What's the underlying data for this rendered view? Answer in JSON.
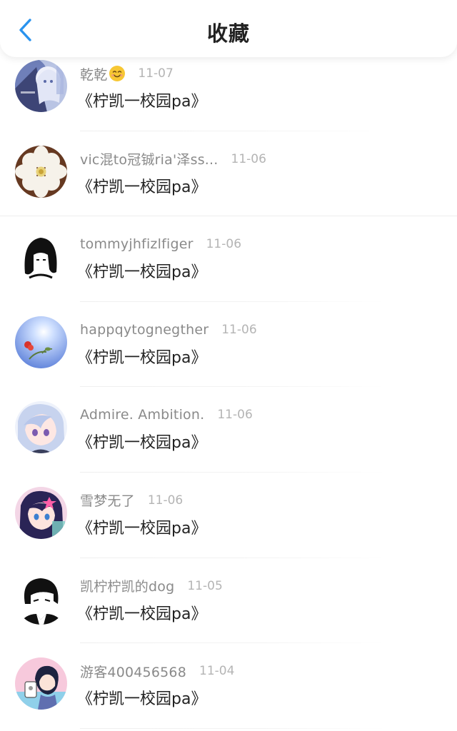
{
  "header": {
    "title": "收藏",
    "back_icon": "chevron-left-icon",
    "accent_color": "#2a93ee"
  },
  "items": [
    {
      "name": "乾乾",
      "has_emoji": true,
      "emoji_icon": "smiling-face-icon",
      "date": "11-07",
      "title": "《柠凯一校园pa》"
    },
    {
      "name": "vic混to冠铖ria'泽ss...",
      "date": "11-06",
      "title": "《柠凯一校园pa》"
    },
    {
      "name": "tommyjhfizlfiger",
      "date": "11-06",
      "title": "《柠凯一校园pa》"
    },
    {
      "name": "happqytognegther",
      "date": "11-06",
      "title": "《柠凯一校园pa》"
    },
    {
      "name": "Admire. Ambition.",
      "date": "11-06",
      "title": "《柠凯一校园pa》"
    },
    {
      "name": "雪梦无了",
      "date": "11-06",
      "title": "《柠凯一校园pa》"
    },
    {
      "name": "凯柠柠凯的dog",
      "date": "11-05",
      "title": "《柠凯一校园pa》"
    },
    {
      "name": "游客400456568",
      "date": "11-04",
      "title": "《柠凯一校园pa》"
    }
  ]
}
